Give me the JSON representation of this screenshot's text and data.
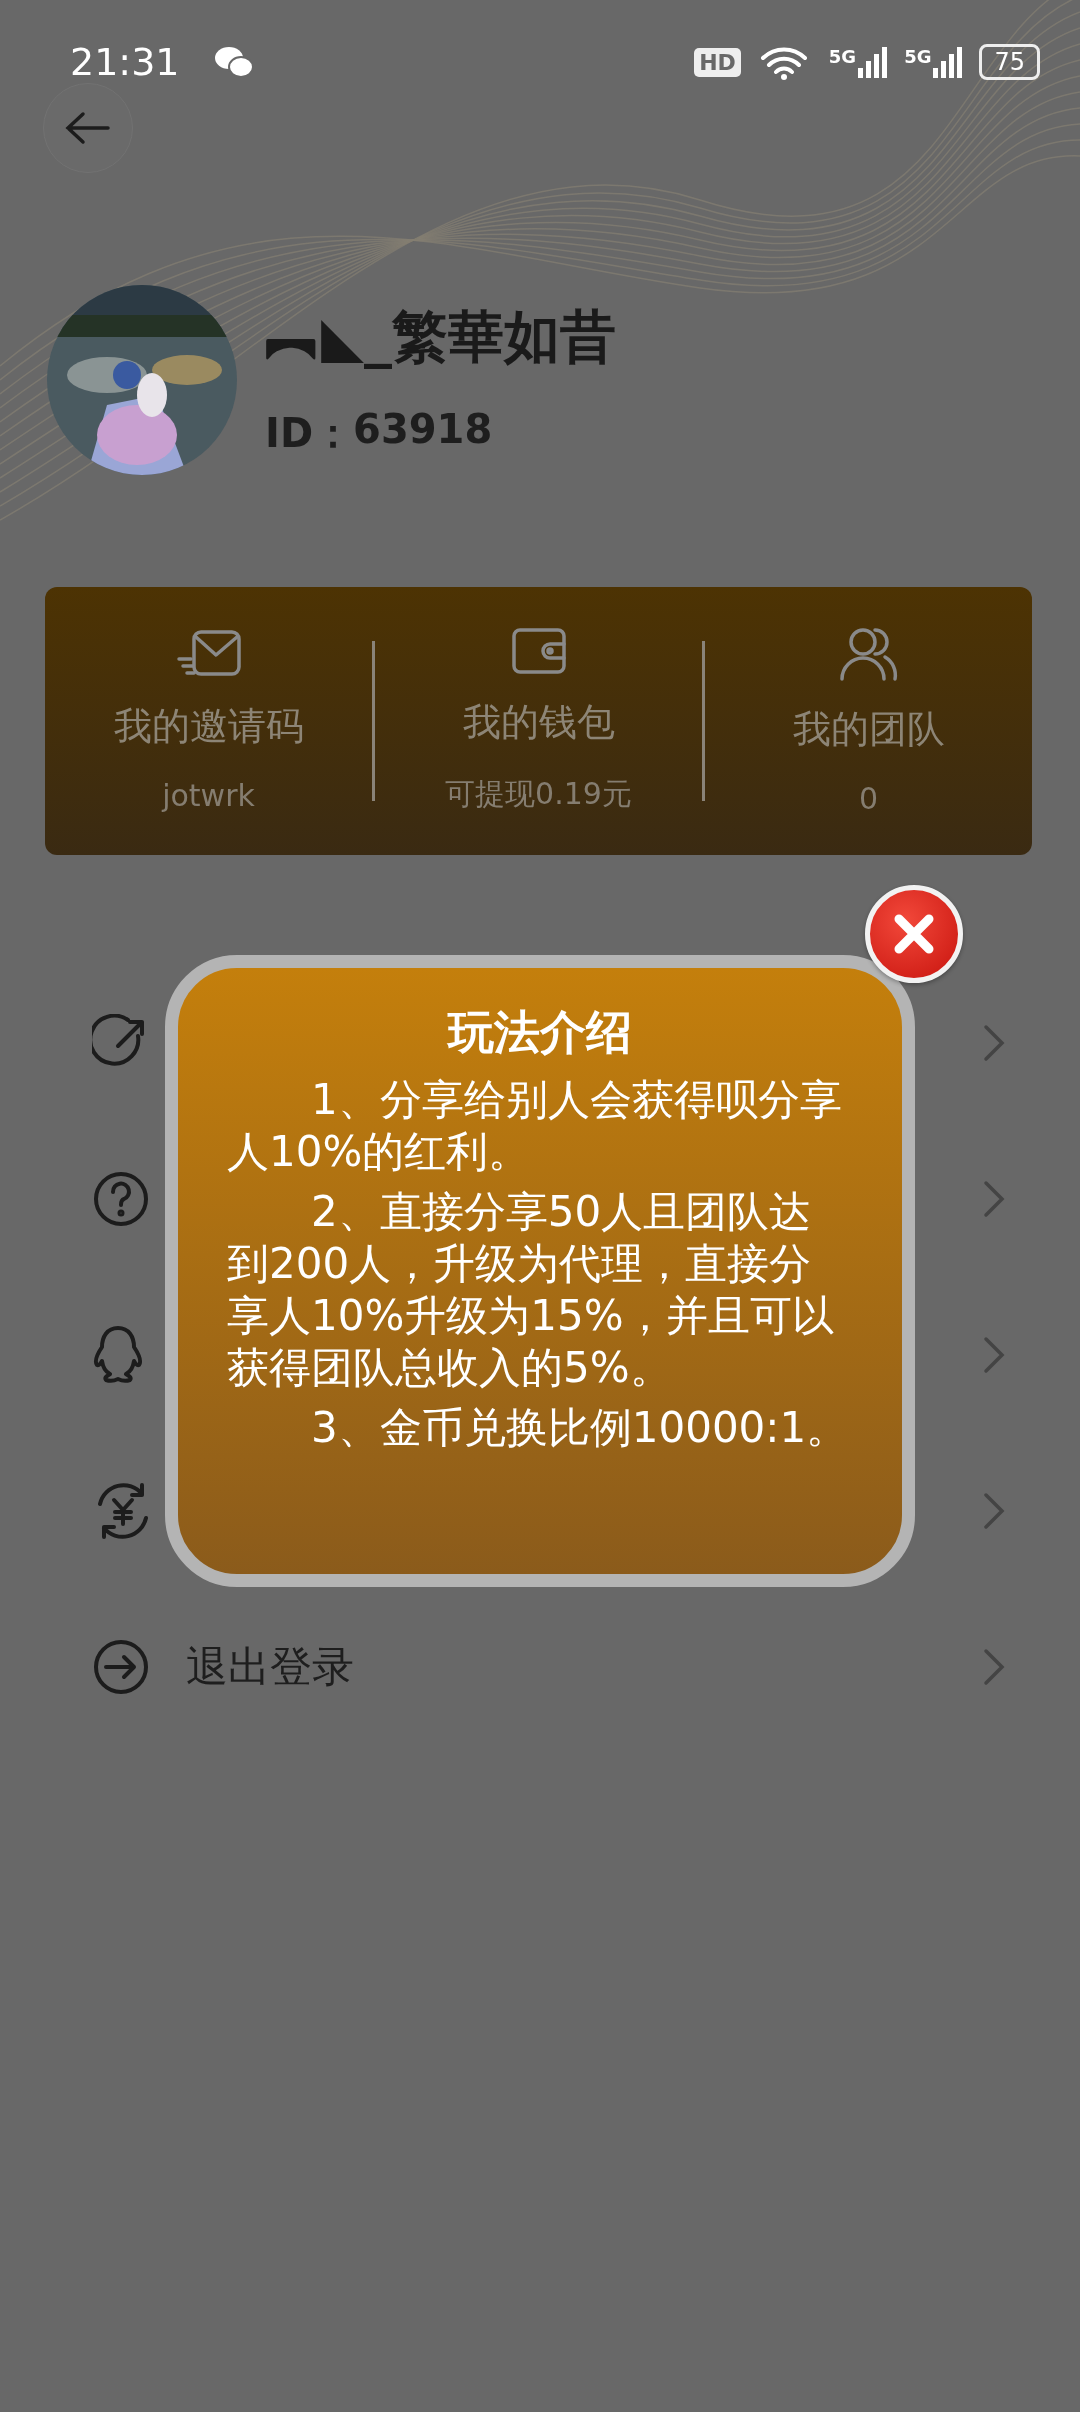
{
  "status_bar": {
    "time": "21:31",
    "hd": "HD",
    "networks": [
      "5G",
      "5G"
    ],
    "battery": "75"
  },
  "profile": {
    "name": "︻◣_繁華如昔",
    "id_label": "ID：",
    "id_value": "63918"
  },
  "stats": [
    {
      "kind": "invite",
      "title": "我的邀请码",
      "value": "jotwrk"
    },
    {
      "kind": "wallet",
      "title": "我的钱包",
      "value": "可提现0.19元"
    },
    {
      "kind": "team",
      "title": "我的团队",
      "value": "0"
    }
  ],
  "menu": [
    {
      "kind": "share"
    },
    {
      "kind": "help"
    },
    {
      "kind": "chat"
    },
    {
      "kind": "exchange"
    },
    {
      "kind": "logout",
      "label": "退出登录"
    }
  ],
  "dialog": {
    "title": "玩法介绍",
    "paragraphs": [
      "1、分享给别人会获得呗分享人10%的红利。",
      "2、直接分享50人且团队达到200人，升级为代理，直接分享人10%升级为15%，并且可以获得团队总收入的5%。",
      "3、金币兑换比例10000:1。"
    ]
  }
}
